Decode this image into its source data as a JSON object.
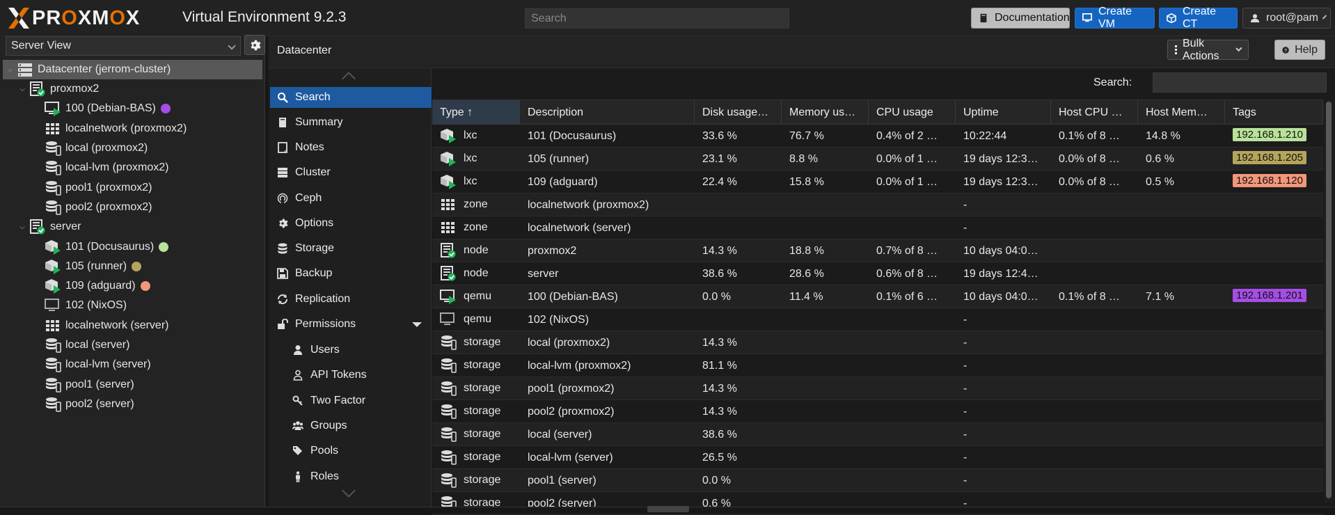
{
  "app": {
    "logo_pre": "PR",
    "logo_o1": "O",
    "logo_mid": "XM",
    "logo_o2": "O",
    "logo_post": "X",
    "subtitle": "Virtual Environment 9.2.3"
  },
  "topbar": {
    "search_placeholder": "Search",
    "documentation": "Documentation",
    "create_vm": "Create VM",
    "create_ct": "Create CT",
    "user": "root@pam"
  },
  "left": {
    "view": "Server View",
    "tree": [
      {
        "label": "Datacenter (jerrom-cluster)",
        "icon": "datacenter-icon",
        "level": 0,
        "toggle": true,
        "selected": true
      },
      {
        "label": "proxmox2",
        "icon": "node-online-icon",
        "level": 1,
        "toggle": true
      },
      {
        "label": "100 (Debian-BAS)",
        "icon": "vm-running-icon",
        "level": 2,
        "dot": "#a54ee6"
      },
      {
        "label": "localnetwork (proxmox2)",
        "icon": "sdn-zone-icon",
        "level": 2
      },
      {
        "label": "local (proxmox2)",
        "icon": "storage-icon",
        "level": 2
      },
      {
        "label": "local-lvm (proxmox2)",
        "icon": "storage-icon",
        "level": 2
      },
      {
        "label": "pool1 (proxmox2)",
        "icon": "storage-icon",
        "level": 2
      },
      {
        "label": "pool2 (proxmox2)",
        "icon": "storage-icon",
        "level": 2
      },
      {
        "label": "server",
        "icon": "node-online-icon",
        "level": 1,
        "toggle": true
      },
      {
        "label": "101 (Docusaurus)",
        "icon": "ct-running-icon",
        "level": 2,
        "dot": "#b9e29a"
      },
      {
        "label": "105 (runner)",
        "icon": "ct-running-icon",
        "level": 2,
        "dot": "#b5a55c"
      },
      {
        "label": "109 (adguard)",
        "icon": "ct-running-icon",
        "level": 2,
        "dot": "#f2977a"
      },
      {
        "label": "102 (NixOS)",
        "icon": "vm-stopped-icon",
        "level": 2
      },
      {
        "label": "localnetwork (server)",
        "icon": "sdn-zone-icon",
        "level": 2
      },
      {
        "label": "local (server)",
        "icon": "storage-icon",
        "level": 2
      },
      {
        "label": "local-lvm (server)",
        "icon": "storage-icon",
        "level": 2
      },
      {
        "label": "pool1 (server)",
        "icon": "storage-icon",
        "level": 2
      },
      {
        "label": "pool2 (server)",
        "icon": "storage-icon",
        "level": 2
      }
    ]
  },
  "header": {
    "title": "Datacenter",
    "bulk_actions": "Bulk Actions",
    "help": "Help"
  },
  "nav": [
    {
      "label": "Search",
      "icon": "search-icon",
      "selected": true
    },
    {
      "label": "Summary",
      "icon": "book-icon"
    },
    {
      "label": "Notes",
      "icon": "notes-icon"
    },
    {
      "label": "Cluster",
      "icon": "cluster-icon"
    },
    {
      "label": "Ceph",
      "icon": "ceph-icon"
    },
    {
      "label": "Options",
      "icon": "gear-icon"
    },
    {
      "label": "Storage",
      "icon": "database-icon"
    },
    {
      "label": "Backup",
      "icon": "floppy-icon"
    },
    {
      "label": "Replication",
      "icon": "replication-icon"
    },
    {
      "label": "Permissions",
      "icon": "unlock-icon",
      "caret": true
    },
    {
      "label": "Users",
      "icon": "user-icon",
      "sub": true
    },
    {
      "label": "API Tokens",
      "icon": "user-outline-icon",
      "sub": true
    },
    {
      "label": "Two Factor",
      "icon": "key-icon",
      "sub": true
    },
    {
      "label": "Groups",
      "icon": "users-icon",
      "sub": true
    },
    {
      "label": "Pools",
      "icon": "tags-icon",
      "sub": true
    },
    {
      "label": "Roles",
      "icon": "male-icon",
      "sub": true
    }
  ],
  "grid": {
    "search_label": "Search:",
    "columns": [
      "Type ↑",
      "Description",
      "Disk usage…",
      "Memory us…",
      "CPU usage",
      "Uptime",
      "Host CPU …",
      "Host Mem…",
      "Tags"
    ],
    "rows": [
      {
        "type": "lxc",
        "icon": "ct-running-icon",
        "desc": "101 (Docusaurus)",
        "disk": "33.6 %",
        "mem": "76.7 %",
        "cpu": "0.4% of 2 …",
        "uptime": "10:22:44",
        "hcpu": "0.1% of 8 …",
        "hmem": "14.8 %",
        "tag": "192.168.1.210",
        "tag_color": "#b9e29a"
      },
      {
        "type": "lxc",
        "icon": "ct-running-icon",
        "desc": "105 (runner)",
        "disk": "23.1 %",
        "mem": "8.8 %",
        "cpu": "0.0% of 1 …",
        "uptime": "19 days 12:3…",
        "hcpu": "0.0% of 8 …",
        "hmem": "0.6 %",
        "tag": "192.168.1.205",
        "tag_color": "#b5a55c"
      },
      {
        "type": "lxc",
        "icon": "ct-running-icon",
        "desc": "109 (adguard)",
        "disk": "22.4 %",
        "mem": "15.8 %",
        "cpu": "0.0% of 1 …",
        "uptime": "19 days 12:3…",
        "hcpu": "0.0% of 8 …",
        "hmem": "0.5 %",
        "tag": "192.168.1.120",
        "tag_color": "#f2977a"
      },
      {
        "type": "zone",
        "icon": "sdn-zone-icon",
        "desc": "localnetwork (proxmox2)",
        "disk": "",
        "mem": "",
        "cpu": "",
        "uptime": "-",
        "hcpu": "",
        "hmem": "",
        "tag": ""
      },
      {
        "type": "zone",
        "icon": "sdn-zone-icon",
        "desc": "localnetwork (server)",
        "disk": "",
        "mem": "",
        "cpu": "",
        "uptime": "-",
        "hcpu": "",
        "hmem": "",
        "tag": ""
      },
      {
        "type": "node",
        "icon": "node-online-icon",
        "desc": "proxmox2",
        "disk": "14.3 %",
        "mem": "18.8 %",
        "cpu": "0.7% of 8 …",
        "uptime": "10 days 04:0…",
        "hcpu": "",
        "hmem": "",
        "tag": ""
      },
      {
        "type": "node",
        "icon": "node-online-icon",
        "desc": "server",
        "disk": "38.6 %",
        "mem": "28.6 %",
        "cpu": "0.6% of 8 …",
        "uptime": "19 days 12:4…",
        "hcpu": "",
        "hmem": "",
        "tag": ""
      },
      {
        "type": "qemu",
        "icon": "vm-running-icon",
        "desc": "100 (Debian-BAS)",
        "disk": "0.0 %",
        "mem": "11.4 %",
        "cpu": "0.1% of 6 …",
        "uptime": "10 days 04:0…",
        "hcpu": "0.1% of 8 …",
        "hmem": "7.1 %",
        "tag": "192.168.1.201",
        "tag_color": "#a54ee6"
      },
      {
        "type": "qemu",
        "icon": "vm-stopped-icon",
        "desc": "102 (NixOS)",
        "disk": "",
        "mem": "",
        "cpu": "",
        "uptime": "-",
        "hcpu": "",
        "hmem": "",
        "tag": ""
      },
      {
        "type": "storage",
        "icon": "storage-icon",
        "desc": "local (proxmox2)",
        "disk": "14.3 %",
        "mem": "",
        "cpu": "",
        "uptime": "-",
        "hcpu": "",
        "hmem": "",
        "tag": ""
      },
      {
        "type": "storage",
        "icon": "storage-icon",
        "desc": "local-lvm (proxmox2)",
        "disk": "81.1 %",
        "mem": "",
        "cpu": "",
        "uptime": "-",
        "hcpu": "",
        "hmem": "",
        "tag": ""
      },
      {
        "type": "storage",
        "icon": "storage-icon",
        "desc": "pool1 (proxmox2)",
        "disk": "14.3 %",
        "mem": "",
        "cpu": "",
        "uptime": "-",
        "hcpu": "",
        "hmem": "",
        "tag": ""
      },
      {
        "type": "storage",
        "icon": "storage-icon",
        "desc": "pool2 (proxmox2)",
        "disk": "14.3 %",
        "mem": "",
        "cpu": "",
        "uptime": "-",
        "hcpu": "",
        "hmem": "",
        "tag": ""
      },
      {
        "type": "storage",
        "icon": "storage-icon",
        "desc": "local (server)",
        "disk": "38.6 %",
        "mem": "",
        "cpu": "",
        "uptime": "-",
        "hcpu": "",
        "hmem": "",
        "tag": ""
      },
      {
        "type": "storage",
        "icon": "storage-icon",
        "desc": "local-lvm (server)",
        "disk": "26.5 %",
        "mem": "",
        "cpu": "",
        "uptime": "-",
        "hcpu": "",
        "hmem": "",
        "tag": ""
      },
      {
        "type": "storage",
        "icon": "storage-icon",
        "desc": "pool1 (server)",
        "disk": "0.0 %",
        "mem": "",
        "cpu": "",
        "uptime": "-",
        "hcpu": "",
        "hmem": "",
        "tag": ""
      },
      {
        "type": "storage",
        "icon": "storage-icon",
        "desc": "pool2 (server)",
        "disk": "0.6 %",
        "mem": "",
        "cpu": "",
        "uptime": "-",
        "hcpu": "",
        "hmem": "",
        "tag": ""
      }
    ]
  },
  "colors": {
    "accent": "#1d5aa0",
    "brand_orange": "#e57000",
    "button_blue": "#1565c0",
    "running_green": "#2ecc40"
  }
}
